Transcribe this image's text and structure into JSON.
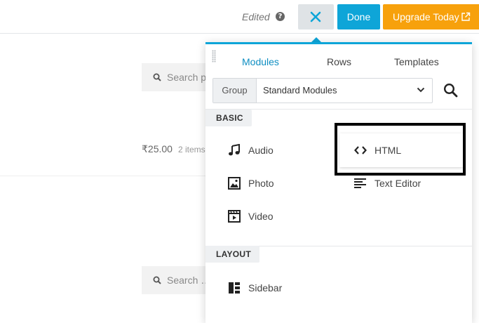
{
  "toolbar": {
    "edited_label": "Edited",
    "help_icon": "?",
    "close_icon": "close-icon",
    "done_label": "Done",
    "upgrade_label": "Upgrade Today",
    "colors": {
      "done": "#0ea5d8",
      "upgrade": "#f7a10c",
      "close_bg": "#dfe3e6"
    }
  },
  "background_page": {
    "search_placeholder_1": "Search pr",
    "price": "₹25.00",
    "items": "2 items",
    "search_placeholder_2": "Search …"
  },
  "panel": {
    "tabs": [
      {
        "label": "Modules",
        "active": true
      },
      {
        "label": "Rows",
        "active": false
      },
      {
        "label": "Templates",
        "active": false
      }
    ],
    "group": {
      "label": "Group",
      "value": "Standard Modules"
    },
    "accent": "#0ea5d8",
    "sections": [
      {
        "label": "BASIC",
        "modules": [
          {
            "label": "Audio",
            "icon": "music-note-icon"
          },
          {
            "label": "HTML",
            "icon": "code-icon"
          },
          {
            "label": "Photo",
            "icon": "photo-icon"
          },
          {
            "label": "Text Editor",
            "icon": "text-align-icon"
          },
          {
            "label": "Video",
            "icon": "video-icon"
          }
        ]
      },
      {
        "label": "LAYOUT",
        "modules": [
          {
            "label": "Sidebar",
            "icon": "sidebar-icon"
          }
        ]
      }
    ]
  }
}
